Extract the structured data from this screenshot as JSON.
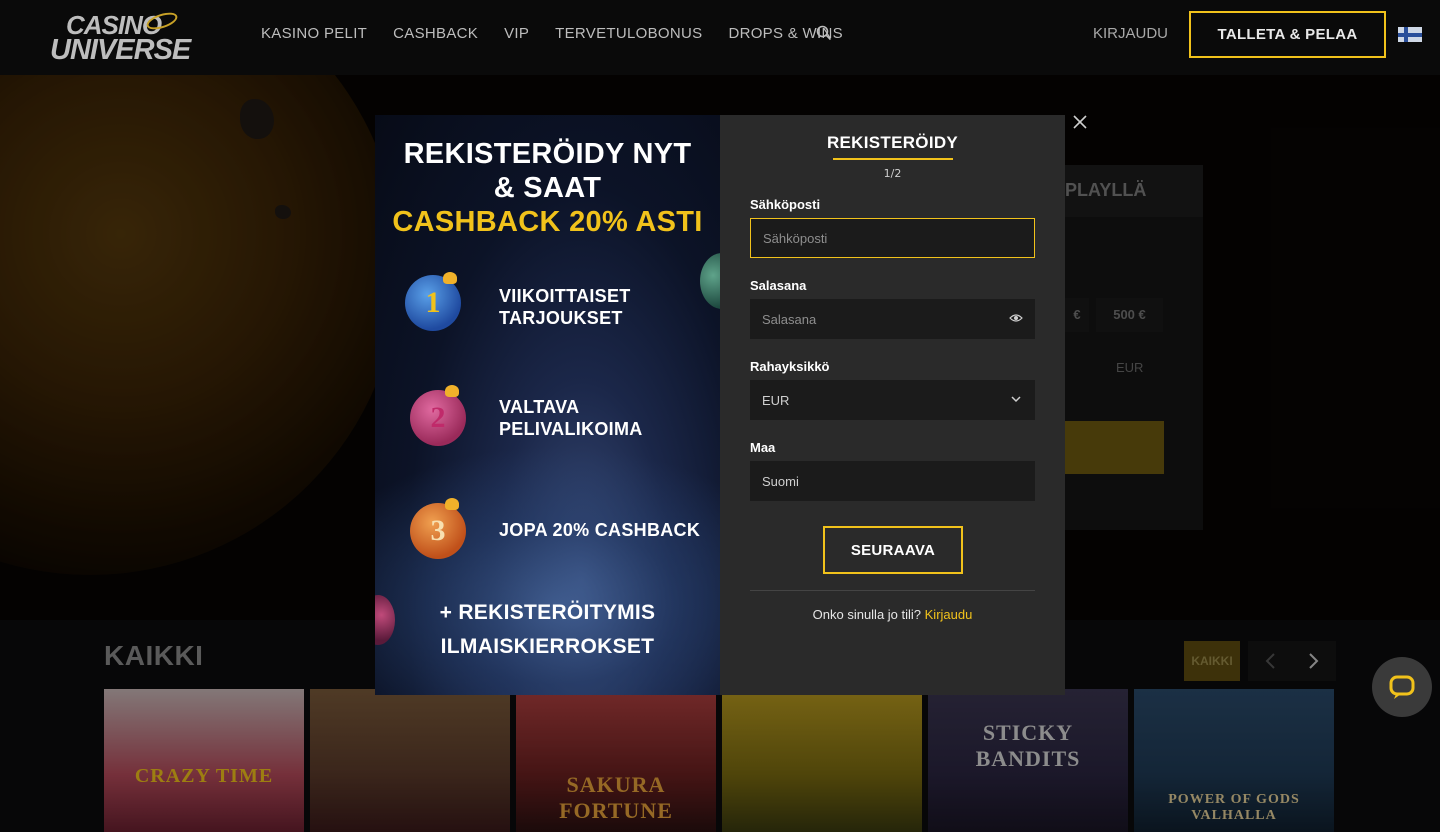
{
  "header": {
    "logo_top": "CASINO",
    "logo_bottom": "UNIVERSE",
    "nav": [
      "KASINO PELIT",
      "CASHBACK",
      "VIP",
      "TERVETULOBONUS",
      "DROPS & WINS"
    ],
    "login": "KIRJAUDU",
    "deposit": "TALLETA & PELAA",
    "language_flag": "finland-flag-icon"
  },
  "background": {
    "deposit_tab": "PLAYLLÄ",
    "amount_a": "€",
    "amount_b": "500 €",
    "currency": "EUR"
  },
  "games": {
    "title": "KAIKKI",
    "all_button": "KAIKKI",
    "tiles": [
      {
        "title": "CRAZY TIME",
        "bg": "#b44a5a"
      },
      {
        "title": "",
        "bg": "#5a3a2a"
      },
      {
        "title": "SAKURA FORTUNE",
        "bg": "#6a2020"
      },
      {
        "title": "",
        "bg": "#7a6a10"
      },
      {
        "title": "STICKY BANDITS",
        "bg": "#2a2540"
      },
      {
        "title": "POWER OF GODS VALHALLA",
        "bg": "#1f3a55"
      }
    ]
  },
  "promo": {
    "line1": "REKISTERÖIDY NYT",
    "line2": "& SAAT",
    "line3": "CASHBACK 20% ASTI",
    "features": [
      {
        "number": "1",
        "text1": "VIIKOITTAISET",
        "text2": "TARJOUKSET"
      },
      {
        "number": "2",
        "text1": "VALTAVA",
        "text2": "PELIVALIKOIMA"
      },
      {
        "number": "3",
        "text1": "JOPA 20% CASHBACK",
        "text2": ""
      }
    ],
    "bonus1": "+ REKISTERÖITYMIS",
    "bonus2": "ILMAISKIERROKSET"
  },
  "form": {
    "title": "REKISTERÖIDY",
    "step": "1/2",
    "email_label": "Sähköposti",
    "email_placeholder": "Sähköposti",
    "password_label": "Salasana",
    "password_placeholder": "Salasana",
    "currency_label": "Rahayksikkö",
    "currency_value": "EUR",
    "country_label": "Maa",
    "country_value": "Suomi",
    "next": "SEURAAVA",
    "has_account": "Onko sinulla jo tili?",
    "login_link": "Kirjaudu"
  },
  "colors": {
    "accent": "#f1c21b",
    "modal_bg": "#2a2a2a",
    "field_bg": "#1b1b1b"
  }
}
